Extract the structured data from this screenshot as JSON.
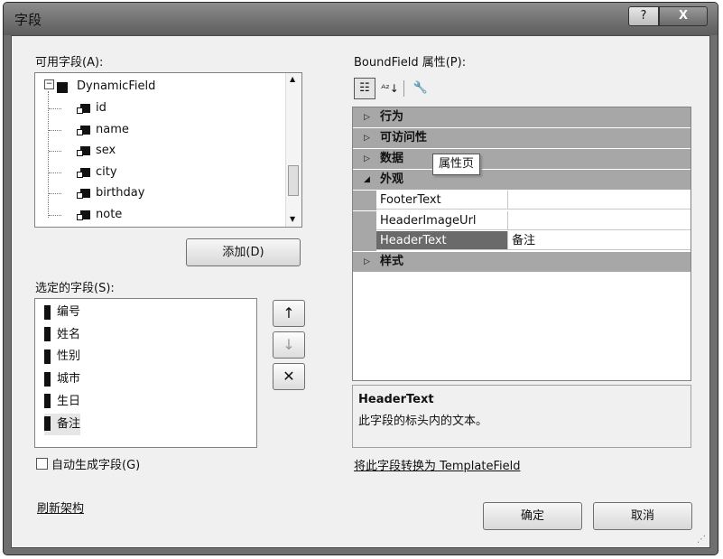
{
  "window": {
    "title": "字段",
    "help_label": "?",
    "close_label": "X"
  },
  "available": {
    "label": "可用字段(A):",
    "root": "DynamicField",
    "fields": [
      "id",
      "name",
      "sex",
      "city",
      "birthday",
      "note"
    ],
    "add_button": "添加(D)"
  },
  "selected": {
    "label": "选定的字段(S):",
    "items": [
      "编号",
      "姓名",
      "性别",
      "城市",
      "生日",
      "备注"
    ]
  },
  "buttons": {
    "up": "↑",
    "down": "↓",
    "delete": "✕",
    "ok": "确定",
    "cancel": "取消"
  },
  "autogen": {
    "label": "自动生成字段(G)",
    "checked": false
  },
  "refresh_link": "刷新架构",
  "properties": {
    "label": "BoundField 属性(P):",
    "tooltip": "属性页",
    "categories": [
      {
        "name": "行为",
        "expanded": false
      },
      {
        "name": "可访问性",
        "expanded": false
      },
      {
        "name": "数据",
        "expanded": false
      },
      {
        "name": "外观",
        "expanded": true
      },
      {
        "name": "样式",
        "expanded": false
      }
    ],
    "rows": [
      {
        "name": "FooterText",
        "value": ""
      },
      {
        "name": "HeaderImageUrl",
        "value": ""
      },
      {
        "name": "HeaderText",
        "value": "备注"
      }
    ],
    "selected_row": "HeaderText",
    "description": {
      "title": "HeaderText",
      "text": "此字段的标头内的文本。"
    },
    "convert_link": "将此字段转换为 TemplateField"
  },
  "toolbar_icons": [
    "categorized-icon",
    "alphabetical-icon",
    "property-pages-icon"
  ]
}
